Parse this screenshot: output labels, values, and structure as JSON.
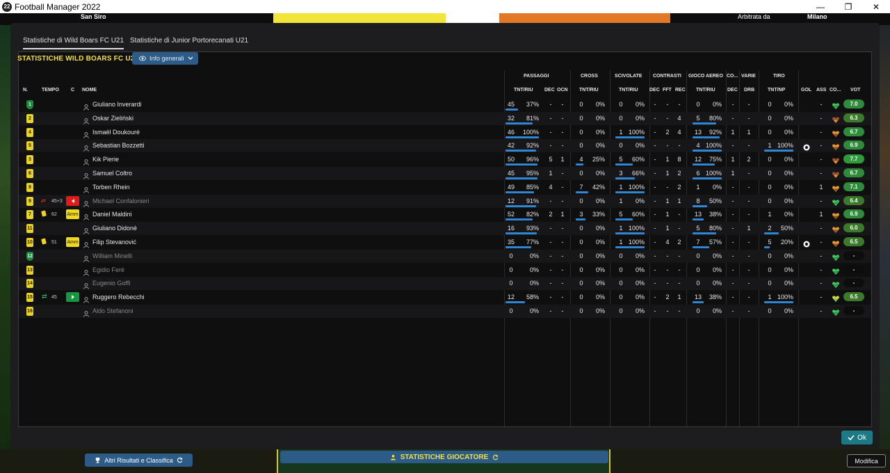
{
  "window": {
    "title": "Football Manager 2022",
    "badge": "22"
  },
  "background": {
    "stadium": "San Siro",
    "referee_label": "Arbitrata da",
    "city": "Milano"
  },
  "tabs": [
    {
      "label": "Statistiche di Wild Boars FC U21",
      "active": true
    },
    {
      "label": "Statistiche di Junior Portorecanati U21",
      "active": false
    }
  ],
  "stats_title": "STATISTICHE WILD BOARS FC U21",
  "info_button": "Info generali",
  "group_headers": {
    "passaggi": "PASSAGGI",
    "cross": "CROSS",
    "scivolate": "SCIVOLATE",
    "contrasti": "CONTRASTI",
    "gioco_aereo": "GIOCO AEREO",
    "co": "CO...",
    "varie": "VARIE",
    "tiro": "TIRO"
  },
  "col_headers": {
    "n": "N.",
    "tempo": "TEMPO",
    "c": "C",
    "nome": "NOME",
    "pass_tnt": "TNT/RIU",
    "pass_dec": "DEC",
    "pass_ocn": "OCN",
    "cross_tnt": "TNT/RIU",
    "sciv_tnt": "TNT/RIU",
    "con_dec": "DEC",
    "con_fft": "FFT",
    "con_rec": "REC",
    "aer_tnt": "TNT/RIU",
    "co_dec": "DEC",
    "varie_drb": "DRB",
    "tiro_tnt": "TNT/NP",
    "gol": "GOL",
    "ass": "ASS",
    "cond": "CO...",
    "vot": "VOT"
  },
  "colors": {
    "accent_yellow": "#f6e03c",
    "bar_blue": "#2f86d4",
    "ok_teal": "#1d7a84",
    "button_blue": "#2b5b86"
  },
  "players": [
    {
      "n": "1",
      "gk": true,
      "name": "Giuliano Inverardi",
      "pass": [
        "45",
        "37%"
      ],
      "pdec": "-",
      "pocn": "-",
      "cross": [
        "0",
        "0%"
      ],
      "sciv": [
        "0",
        "0%"
      ],
      "cdec": "-",
      "cfft": "-",
      "crec": "-",
      "aer": [
        "0",
        "0%"
      ],
      "codec": "-",
      "drb": "-",
      "tiro": [
        "0",
        "0%"
      ],
      "gol": "",
      "ass": "-",
      "heart": "green",
      "vot": "7.0",
      "vc": "#2e8b3a"
    },
    {
      "n": "2",
      "name": "Oskar Zieliński",
      "pass": [
        "32",
        "81%"
      ],
      "pdec": "-",
      "pocn": "-",
      "cross": [
        "0",
        "0%"
      ],
      "sciv": [
        "0",
        "0%"
      ],
      "cdec": "-",
      "cfft": "-",
      "crec": "4",
      "aer": [
        "5",
        "80%"
      ],
      "codec": "-",
      "drb": "-",
      "tiro": [
        "0",
        "0%"
      ],
      "gol": "",
      "ass": "-",
      "heart": "brown",
      "vot": "6.3",
      "vc": "#3a7a2a"
    },
    {
      "n": "4",
      "name": "Ismaël Doukouré",
      "pass": [
        "46",
        "100%"
      ],
      "pdec": "-",
      "pocn": "-",
      "cross": [
        "0",
        "0%"
      ],
      "sciv": [
        "1",
        "100%"
      ],
      "cdec": "-",
      "cfft": "2",
      "crec": "4",
      "aer": [
        "13",
        "92%"
      ],
      "codec": "1",
      "drb": "1",
      "tiro": [
        "0",
        "0%"
      ],
      "gol": "",
      "ass": "-",
      "heart": "orange",
      "vot": "6.7",
      "vc": "#2e8b3a"
    },
    {
      "n": "5",
      "name": "Sebastian Bozzetti",
      "pass": [
        "42",
        "92%"
      ],
      "pdec": "-",
      "pocn": "-",
      "cross": [
        "0",
        "0%"
      ],
      "sciv": [
        "0",
        "0%"
      ],
      "cdec": "-",
      "cfft": "-",
      "crec": "-",
      "aer": [
        "4",
        "100%"
      ],
      "codec": "-",
      "drb": "-",
      "tiro": [
        "1",
        "100%"
      ],
      "gol": "ball",
      "ass": "-",
      "heart": "orange",
      "vot": "6.9",
      "vc": "#2e8b3a"
    },
    {
      "n": "3",
      "name": "Kik Pierie",
      "pass": [
        "50",
        "96%"
      ],
      "pdec": "5",
      "pocn": "1",
      "cross": [
        "4",
        "25%"
      ],
      "sciv": [
        "5",
        "60%"
      ],
      "cdec": "-",
      "cfft": "1",
      "crec": "8",
      "aer": [
        "12",
        "75%"
      ],
      "codec": "1",
      "drb": "2",
      "tiro": [
        "0",
        "0%"
      ],
      "gol": "",
      "ass": "-",
      "heart": "brown",
      "vot": "7.7",
      "vc": "#2e9a3a"
    },
    {
      "n": "6",
      "name": "Samuel Coltro",
      "pass": [
        "45",
        "95%"
      ],
      "pdec": "1",
      "pocn": "-",
      "cross": [
        "0",
        "0%"
      ],
      "sciv": [
        "3",
        "66%"
      ],
      "cdec": "-",
      "cfft": "1",
      "crec": "2",
      "aer": [
        "6",
        "100%"
      ],
      "codec": "1",
      "drb": "-",
      "tiro": [
        "0",
        "0%"
      ],
      "gol": "",
      "ass": "-",
      "heart": "brown",
      "vot": "6.7",
      "vc": "#2e8b3a"
    },
    {
      "n": "8",
      "name": "Torben Rhein",
      "pass": [
        "49",
        "85%"
      ],
      "pdec": "4",
      "pocn": "-",
      "cross": [
        "7",
        "42%"
      ],
      "sciv": [
        "1",
        "100%"
      ],
      "cdec": "-",
      "cfft": "-",
      "crec": "2",
      "aer": [
        "1",
        "0%"
      ],
      "codec": "-",
      "drb": "-",
      "tiro": [
        "0",
        "0%"
      ],
      "gol": "",
      "ass": "1",
      "heart": "orange",
      "vot": "7.1",
      "vc": "#2e8b3a"
    },
    {
      "n": "9",
      "name": "Michael Confalonieri",
      "dim": true,
      "tempo_icon": "out",
      "tempo": "45+3",
      "cbadge": "red",
      "pass": [
        "12",
        "91%"
      ],
      "pdec": "-",
      "pocn": "-",
      "cross": [
        "0",
        "0%"
      ],
      "sciv": [
        "1",
        "0%"
      ],
      "cdec": "-",
      "cfft": "1",
      "crec": "1",
      "aer": [
        "8",
        "50%"
      ],
      "codec": "-",
      "drb": "-",
      "tiro": [
        "0",
        "0%"
      ],
      "gol": "",
      "ass": "-",
      "heart": "green",
      "vot": "6.4",
      "vc": "#3a7a2a"
    },
    {
      "n": "7",
      "name": "Daniel Maldini",
      "tempo_icon": "yellow",
      "tempo": "62",
      "cbadge": "amm",
      "cbadge_text": "Amm",
      "pass": [
        "52",
        "82%"
      ],
      "pdec": "2",
      "pocn": "1",
      "cross": [
        "3",
        "33%"
      ],
      "sciv": [
        "5",
        "60%"
      ],
      "cdec": "-",
      "cfft": "1",
      "crec": "-",
      "aer": [
        "13",
        "38%"
      ],
      "codec": "-",
      "drb": "-",
      "tiro": [
        "1",
        "0%"
      ],
      "gol": "",
      "ass": "1",
      "heart": "orange",
      "vot": "6.9",
      "vc": "#2e8b3a"
    },
    {
      "n": "11",
      "name": "Giuliano Didonè",
      "pass": [
        "16",
        "93%"
      ],
      "pdec": "-",
      "pocn": "-",
      "cross": [
        "0",
        "0%"
      ],
      "sciv": [
        "1",
        "100%"
      ],
      "cdec": "-",
      "cfft": "1",
      "crec": "-",
      "aer": [
        "5",
        "80%"
      ],
      "codec": "-",
      "drb": "1",
      "tiro": [
        "2",
        "50%"
      ],
      "gol": "",
      "ass": "-",
      "heart": "orange",
      "vot": "6.0",
      "vc": "#3a7a2a"
    },
    {
      "n": "10",
      "name": "Filip Stevanović",
      "tempo_icon": "yellow",
      "tempo": "51",
      "cbadge": "amm",
      "cbadge_text": "Amm",
      "pass": [
        "35",
        "77%"
      ],
      "pdec": "-",
      "pocn": "-",
      "cross": [
        "0",
        "0%"
      ],
      "sciv": [
        "1",
        "100%"
      ],
      "cdec": "-",
      "cfft": "4",
      "crec": "2",
      "aer": [
        "7",
        "57%"
      ],
      "codec": "-",
      "drb": "-",
      "tiro": [
        "5",
        "20%"
      ],
      "gol": "ball",
      "ass": "-",
      "heart": "orange",
      "vot": "6.5",
      "vc": "#3a7a2a"
    },
    {
      "n": "12",
      "gk": true,
      "name": "William Minelli",
      "dim": true,
      "pass": [
        "0",
        "0%"
      ],
      "pdec": "-",
      "pocn": "-",
      "cross": [
        "0",
        "0%"
      ],
      "sciv": [
        "0",
        "0%"
      ],
      "cdec": "-",
      "cfft": "-",
      "crec": "-",
      "aer": [
        "0",
        "0%"
      ],
      "codec": "-",
      "drb": "-",
      "tiro": [
        "0",
        "0%"
      ],
      "gol": "",
      "ass": "-",
      "heart": "green",
      "vot": "-",
      "vc": "none"
    },
    {
      "n": "13",
      "name": "Egidio Ferè",
      "dim": true,
      "pass": [
        "0",
        "0%"
      ],
      "pdec": "-",
      "pocn": "-",
      "cross": [
        "0",
        "0%"
      ],
      "sciv": [
        "0",
        "0%"
      ],
      "cdec": "-",
      "cfft": "-",
      "crec": "-",
      "aer": [
        "0",
        "0%"
      ],
      "codec": "-",
      "drb": "-",
      "tiro": [
        "0",
        "0%"
      ],
      "gol": "",
      "ass": "-",
      "heart": "green",
      "vot": "-",
      "vc": "none"
    },
    {
      "n": "14",
      "name": "Eugenio Goffi",
      "dim": true,
      "pass": [
        "0",
        "0%"
      ],
      "pdec": "-",
      "pocn": "-",
      "cross": [
        "0",
        "0%"
      ],
      "sciv": [
        "0",
        "0%"
      ],
      "cdec": "-",
      "cfft": "-",
      "crec": "-",
      "aer": [
        "0",
        "0%"
      ],
      "codec": "-",
      "drb": "-",
      "tiro": [
        "0",
        "0%"
      ],
      "gol": "",
      "ass": "-",
      "heart": "green",
      "vot": "-",
      "vc": "none"
    },
    {
      "n": "15",
      "name": "Ruggero Rebecchi",
      "tempo_icon": "in",
      "tempo": "45",
      "cbadge": "grn",
      "pass": [
        "12",
        "58%"
      ],
      "pdec": "-",
      "pocn": "-",
      "cross": [
        "0",
        "0%"
      ],
      "sciv": [
        "0",
        "0%"
      ],
      "cdec": "-",
      "cfft": "2",
      "crec": "1",
      "aer": [
        "13",
        "38%"
      ],
      "codec": "-",
      "drb": "-",
      "tiro": [
        "1",
        "100%"
      ],
      "gol": "",
      "ass": "-",
      "heart": "yellowgreen",
      "vot": "6.5",
      "vc": "#3a7a2a"
    },
    {
      "n": "16",
      "name": "Aldo Stefanoni",
      "dim": true,
      "pass": [
        "0",
        "0%"
      ],
      "pdec": "-",
      "pocn": "-",
      "cross": [
        "0",
        "0%"
      ],
      "sciv": [
        "0",
        "0%"
      ],
      "cdec": "-",
      "cfft": "-",
      "crec": "-",
      "aer": [
        "0",
        "0%"
      ],
      "codec": "-",
      "drb": "-",
      "tiro": [
        "0",
        "0%"
      ],
      "gol": "",
      "ass": "-",
      "heart": "green",
      "vot": "-",
      "vc": "none"
    }
  ],
  "ok_button": "Ok",
  "bottom": {
    "altri": "Altri Risultati e Classifica",
    "stat": "STATISTICHE GIOCATORE",
    "modifica": "Modifica"
  }
}
